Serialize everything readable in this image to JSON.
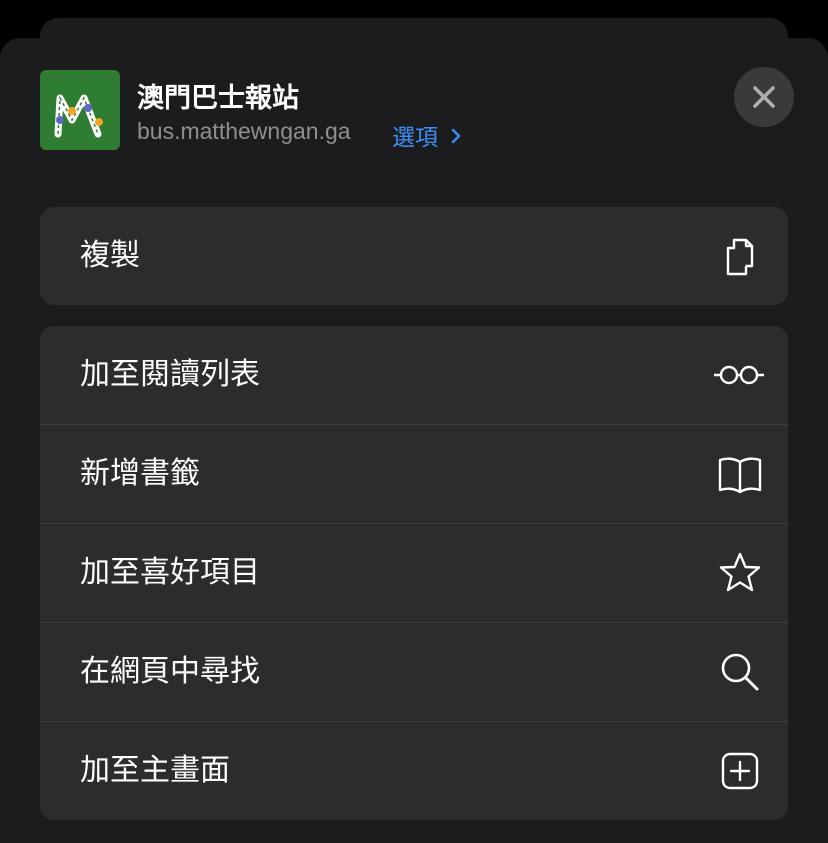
{
  "app": {
    "name": "澳門巴士報站",
    "url": "bus.matthewngan.ga",
    "options_label": "選項",
    "icon_letter": "M",
    "icon_color": "#2e7d32"
  },
  "icons": {
    "close": "close-icon",
    "copy": "copy-icon",
    "reading_list": "glasses-icon",
    "bookmark": "book-icon",
    "favorite": "star-icon",
    "find": "search-icon",
    "home": "add-square-icon",
    "options_chevron": "chevron-right-icon"
  },
  "actions": {
    "copy": "複製",
    "reading_list": "加至閱讀列表",
    "bookmark": "新增書籤",
    "favorite": "加至喜好項目",
    "find": "在網頁中尋找",
    "home": "加至主畫面"
  },
  "colors": {
    "background": "#1c1c1e",
    "row": "#2c2c2e",
    "accent": "#3a8ef5",
    "text": "#ffffff",
    "secondary_text": "#8e8e93"
  }
}
